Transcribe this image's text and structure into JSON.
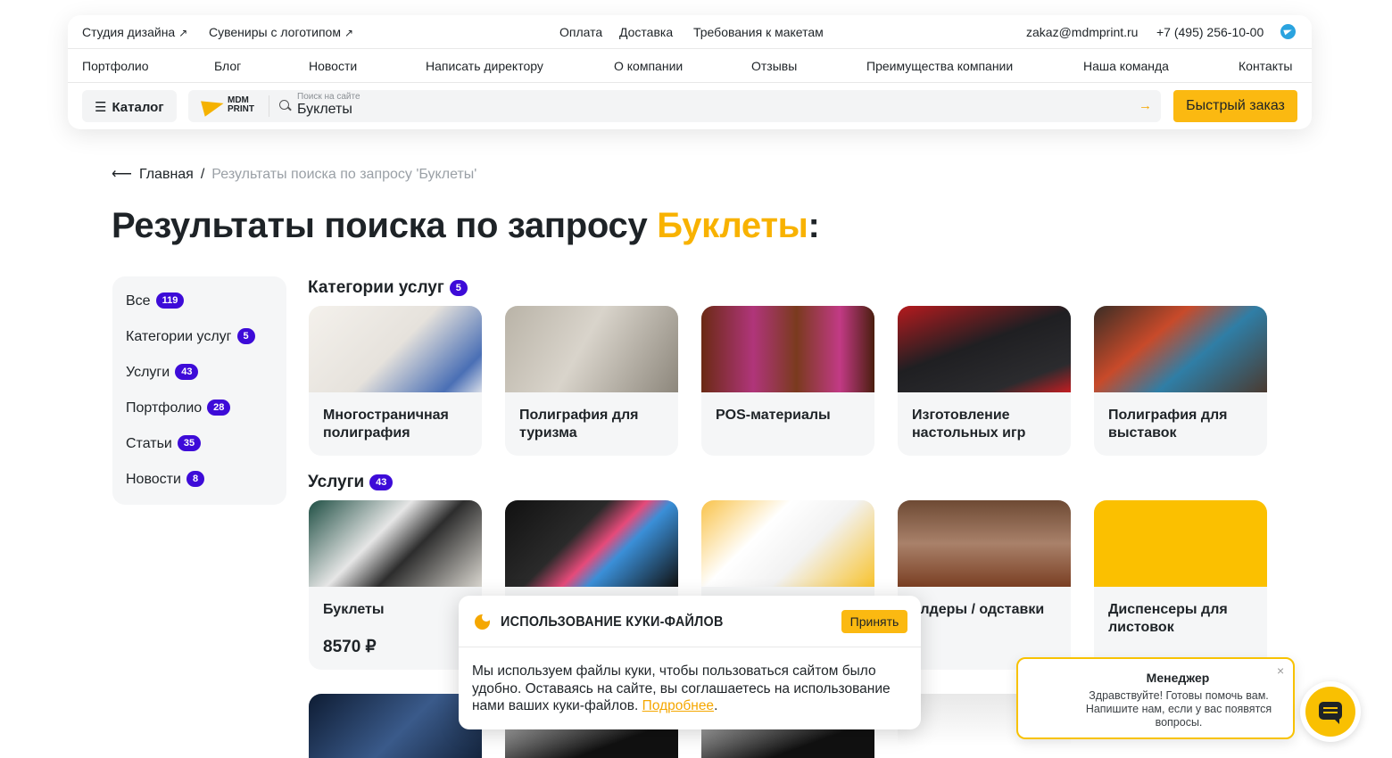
{
  "topbar": {
    "studio": "Студия дизайна",
    "souvenirs": "Сувениры с логотипом",
    "payment": "Оплата",
    "delivery": "Доставка",
    "requirements": "Требования к макетам",
    "email": "zakaz@mdmprint.ru",
    "phone": "+7 (495) 256-10-00"
  },
  "nav": [
    "Портфолио",
    "Блог",
    "Новости",
    "Написать директору",
    "О компании",
    "Отзывы",
    "Преимущества компании",
    "Наша команда",
    "Контакты"
  ],
  "search": {
    "catalog_label": "Каталог",
    "logo_line1": "MDM",
    "logo_line2": "PRINT",
    "placeholder": "Поиск на сайте",
    "value": "Буклеты",
    "quick_order": "Быстрый заказ"
  },
  "breadcrumb": {
    "home": "Главная",
    "separator": "/",
    "current": "Результаты поиска по запросу 'Буклеты'"
  },
  "page_title": {
    "prefix": "Результаты поиска по запросу",
    "query": "Буклеты",
    "suffix": ":"
  },
  "filters": [
    {
      "label": "Все",
      "count": "119"
    },
    {
      "label": "Категории услуг",
      "count": "5"
    },
    {
      "label": "Услуги",
      "count": "43"
    },
    {
      "label": "Портфолио",
      "count": "28"
    },
    {
      "label": "Статьи",
      "count": "35"
    },
    {
      "label": "Новости",
      "count": "8"
    }
  ],
  "categories": {
    "title": "Категории услуг",
    "count": "5",
    "items": [
      {
        "title": "Многостраничная полиграфия"
      },
      {
        "title": "Полиграфия для туризма"
      },
      {
        "title": "POS-материалы"
      },
      {
        "title": "Изготовление настольных игр"
      },
      {
        "title": "Полиграфия для выставок"
      }
    ]
  },
  "services": {
    "title": "Услуги",
    "count": "43",
    "items": [
      {
        "title": "Буклеты",
        "price": "8570 ₽"
      },
      {
        "title": ""
      },
      {
        "title": ""
      },
      {
        "title": "олдеры / одставки"
      },
      {
        "title": "Диспенсеры для листовок"
      }
    ]
  },
  "cookie": {
    "title": "ИСПОЛЬЗОВАНИЕ КУКИ-ФАЙЛОВ",
    "accept": "Принять",
    "text": "Мы используем файлы куки, чтобы пользоваться сайтом было удобно. Оставаясь на сайте, вы соглашаетесь на использование нами ваших куки-файлов.",
    "more": "Подробнее",
    "end": "."
  },
  "chat": {
    "name": "Менеджер",
    "message": "Здравствуйте! Готовы помочь вам. Напишите нам, если у вас появятся вопросы.",
    "close": "×"
  },
  "colors": {
    "accent": "#f8b200",
    "badge": "#3d0bd8",
    "button": "#fbb911"
  }
}
